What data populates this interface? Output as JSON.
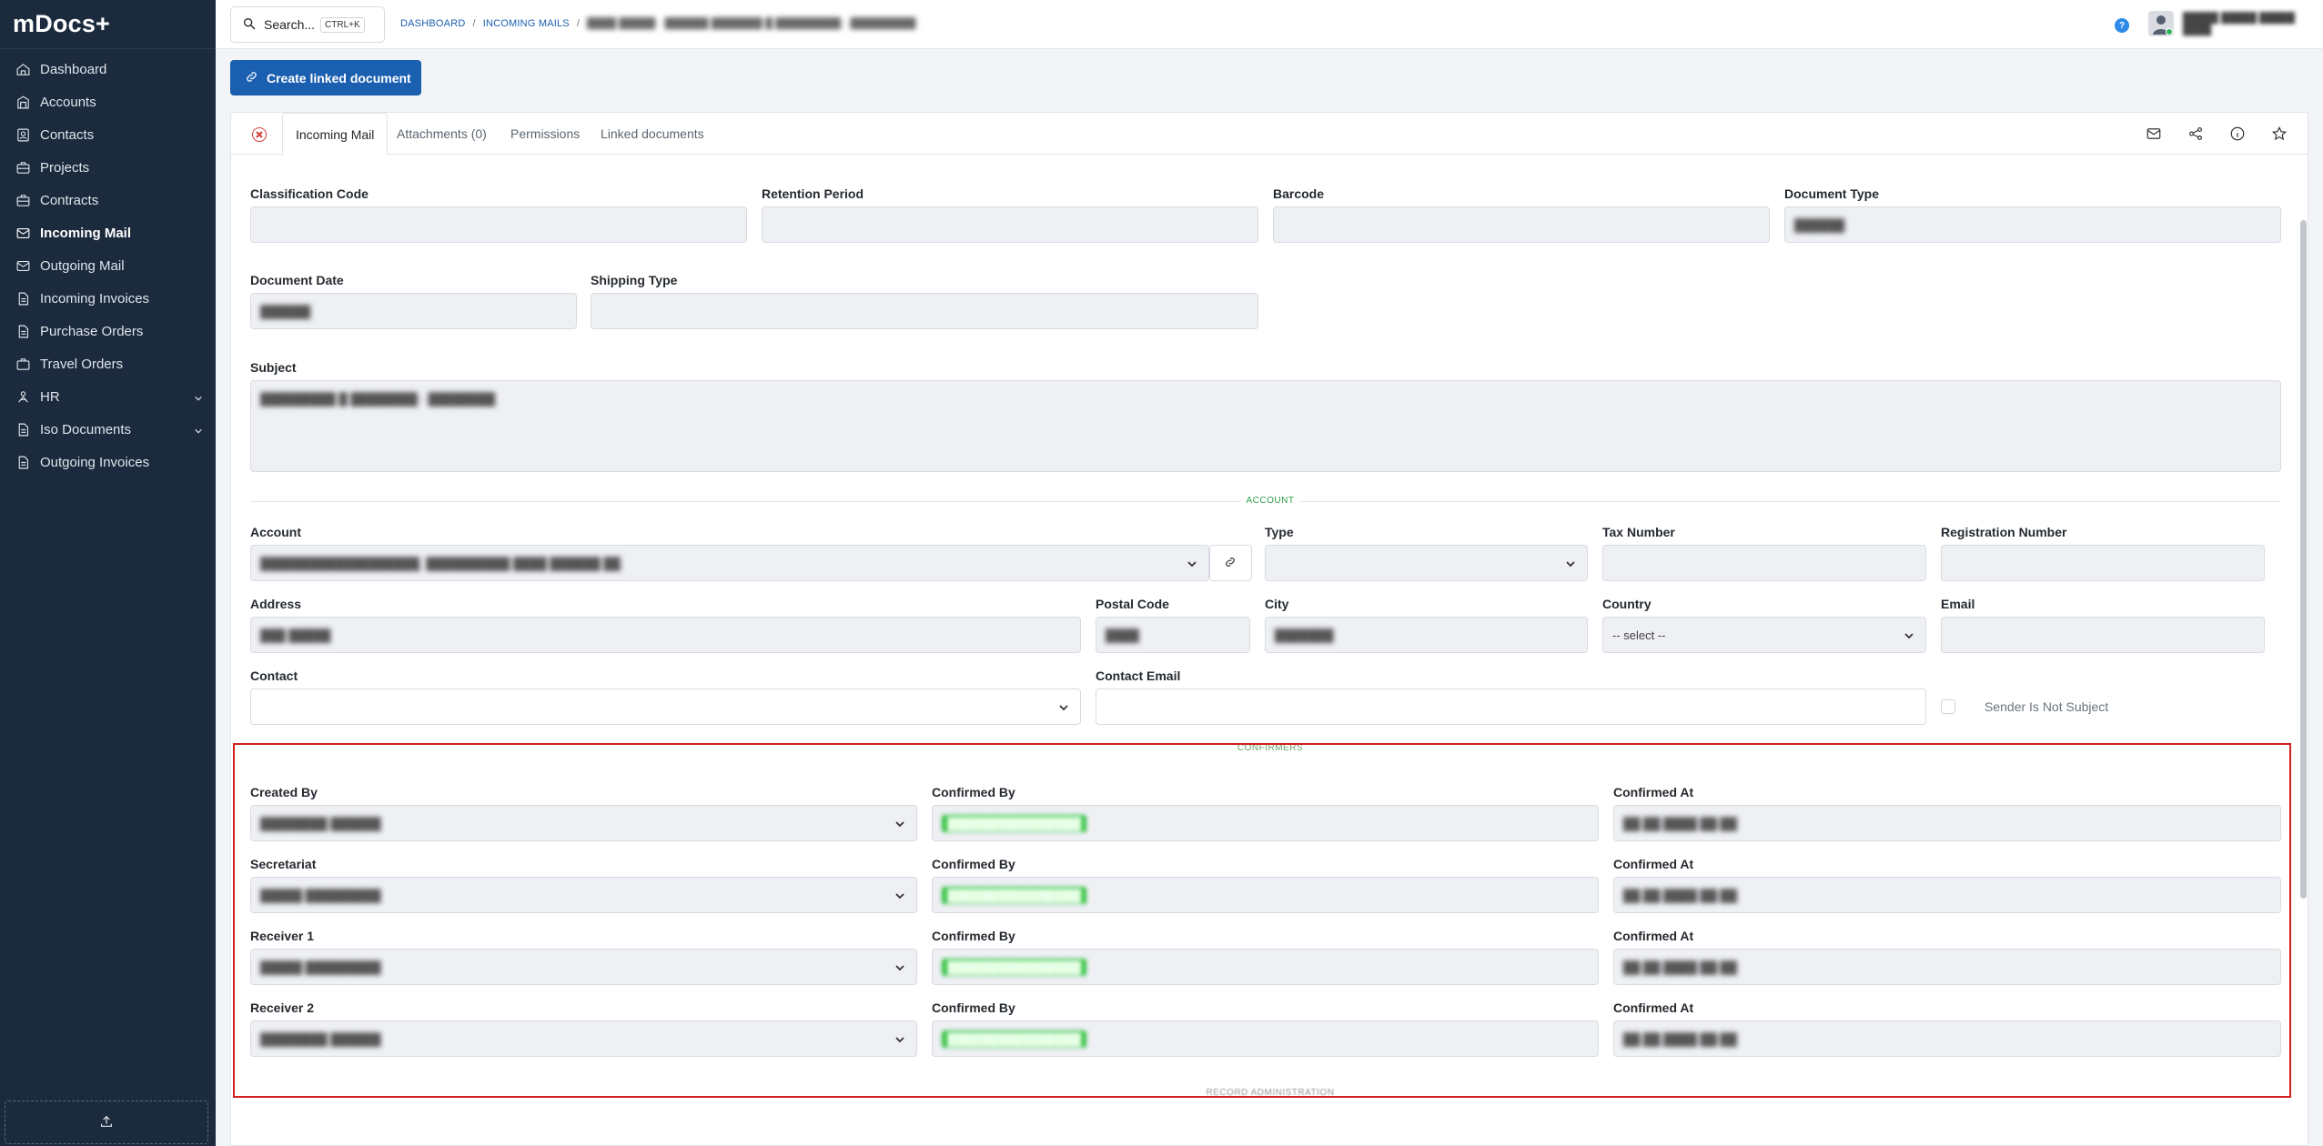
{
  "app": {
    "brand": "mDocs+"
  },
  "sidebar": {
    "items": [
      {
        "label": "Dashboard",
        "icon": "home-icon"
      },
      {
        "label": "Accounts",
        "icon": "building-icon"
      },
      {
        "label": "Contacts",
        "icon": "contacts-icon"
      },
      {
        "label": "Projects",
        "icon": "briefcase-icon"
      },
      {
        "label": "Contracts",
        "icon": "briefcase-icon"
      },
      {
        "label": "Incoming Mail",
        "icon": "mail-icon",
        "active": true
      },
      {
        "label": "Outgoing Mail",
        "icon": "mail-icon"
      },
      {
        "label": "Incoming Invoices",
        "icon": "document-icon"
      },
      {
        "label": "Purchase Orders",
        "icon": "document-icon"
      },
      {
        "label": "Travel Orders",
        "icon": "suitcase-icon"
      },
      {
        "label": "HR",
        "icon": "people-icon",
        "expandable": true
      },
      {
        "label": "Iso Documents",
        "icon": "document-icon",
        "expandable": true
      },
      {
        "label": "Outgoing Invoices",
        "icon": "document-icon"
      }
    ]
  },
  "topbar": {
    "search_label": "Search...",
    "search_shortcut": "CTRL+K",
    "breadcrumb": [
      "DASHBOARD",
      "INCOMING MAILS"
    ],
    "breadcrumb_current": "████ █████ - ██████ ███████ █ █████████ - █████████",
    "help_label": "?",
    "user_line1": "█████ █████ █████",
    "user_line2": "████"
  },
  "actions": {
    "create_linked": "Create linked document"
  },
  "tabs": {
    "items": [
      "Incoming Mail",
      "Attachments (0)",
      "Permissions",
      "Linked documents"
    ]
  },
  "form": {
    "classification_code": {
      "label": "Classification Code",
      "value": ""
    },
    "retention_period": {
      "label": "Retention Period",
      "value": ""
    },
    "barcode": {
      "label": "Barcode",
      "value": ""
    },
    "document_type": {
      "label": "Document Type",
      "value": "██████"
    },
    "document_date": {
      "label": "Document Date",
      "value": "██████"
    },
    "shipping_type": {
      "label": "Shipping Type",
      "value": ""
    },
    "subject": {
      "label": "Subject",
      "value": "█████████ █ ████████ - ████████"
    },
    "account_section": "ACCOUNT",
    "account": {
      "label": "Account",
      "value": "███████████████████, ██████████ ████ ██████ ██."
    },
    "type": {
      "label": "Type",
      "value": ""
    },
    "tax_number": {
      "label": "Tax Number",
      "value": ""
    },
    "registration_number": {
      "label": "Registration Number",
      "value": ""
    },
    "address": {
      "label": "Address",
      "value": "███ █████"
    },
    "postal_code": {
      "label": "Postal Code",
      "value": "████"
    },
    "city": {
      "label": "City",
      "value": "███████"
    },
    "country": {
      "label": "Country",
      "value": "-- select --"
    },
    "email": {
      "label": "Email",
      "value": ""
    },
    "contact": {
      "label": "Contact",
      "value": ""
    },
    "contact_email": {
      "label": "Contact Email",
      "value": ""
    },
    "sender_not_subject": "Sender Is Not Subject",
    "confirmers_section": "CONFIRMERS",
    "confirmers": [
      {
        "role": "Created By",
        "person": "████████ ██████",
        "confirmed_by_label": "Confirmed By",
        "confirmed_by": "████████████████",
        "confirmed_at_label": "Confirmed At",
        "confirmed_at": "██.██.████ ██:██"
      },
      {
        "role": "Secretariat",
        "person": "█████ █████████",
        "confirmed_by_label": "Confirmed By",
        "confirmed_by": "████████████████",
        "confirmed_at_label": "Confirmed At",
        "confirmed_at": "██.██.████ ██:██"
      },
      {
        "role": "Receiver 1",
        "person": "█████ █████████",
        "confirmed_by_label": "Confirmed By",
        "confirmed_by": "████████████████",
        "confirmed_at_label": "Confirmed At",
        "confirmed_at": "██.██.████ ██:██"
      },
      {
        "role": "Receiver 2",
        "person": "████████ ██████",
        "confirmed_by_label": "Confirmed By",
        "confirmed_by": "████████████████",
        "confirmed_at_label": "Confirmed At",
        "confirmed_at": "██.██.████ ██:██"
      }
    ],
    "record_admin_section": "RECORD ADMINISTRATION"
  },
  "colors": {
    "sidebar_bg": "#1b2a3d",
    "primary": "#1b5fb0",
    "section_label": "#2e9e4a",
    "highlight": "#d21f1f",
    "confirmed_pill": "#2fbf3e"
  }
}
